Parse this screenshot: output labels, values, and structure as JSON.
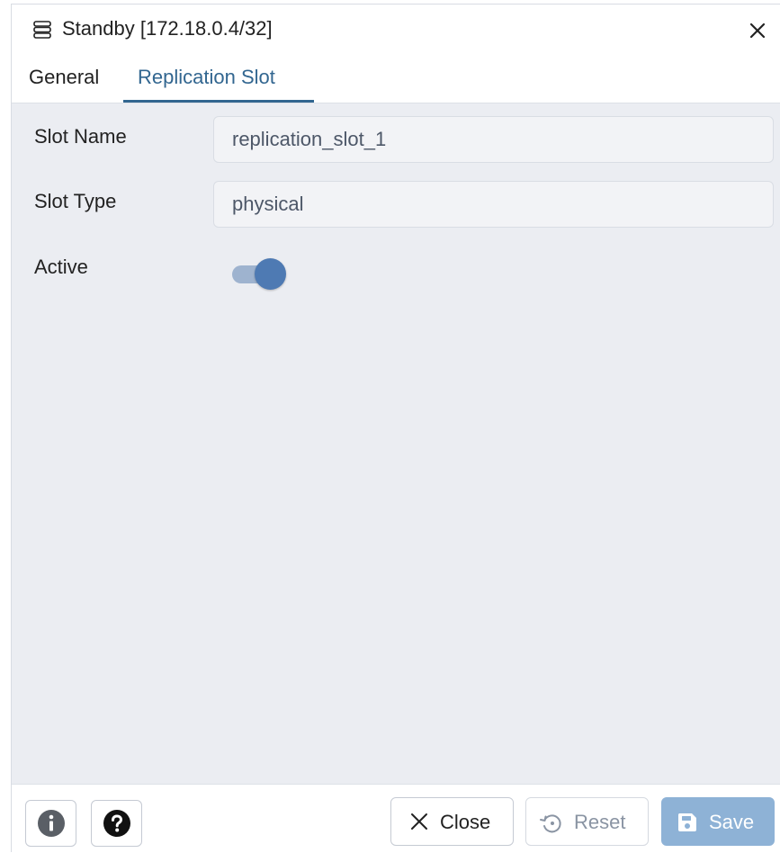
{
  "dialog": {
    "title": "Standby [172.18.0.4/32]",
    "title_icon": "server-stack-icon",
    "close_icon": "close-icon"
  },
  "tabs": [
    {
      "label": "General",
      "active": false
    },
    {
      "label": "Replication Slot",
      "active": true
    }
  ],
  "form": {
    "slot_name": {
      "label": "Slot Name",
      "value": "replication_slot_1"
    },
    "slot_type": {
      "label": "Slot Type",
      "value": "physical"
    },
    "active": {
      "label": "Active",
      "value": true
    }
  },
  "footer": {
    "info_icon": "info-icon",
    "help_icon": "help-icon",
    "close_label": "Close",
    "reset_label": "Reset",
    "save_label": "Save"
  },
  "colors": {
    "accent": "#326690",
    "toggle_thumb": "#4e7ab3",
    "toggle_track": "#9eb3cf",
    "save_button": "#8eb2d6",
    "content_bg": "#ebedf2"
  }
}
